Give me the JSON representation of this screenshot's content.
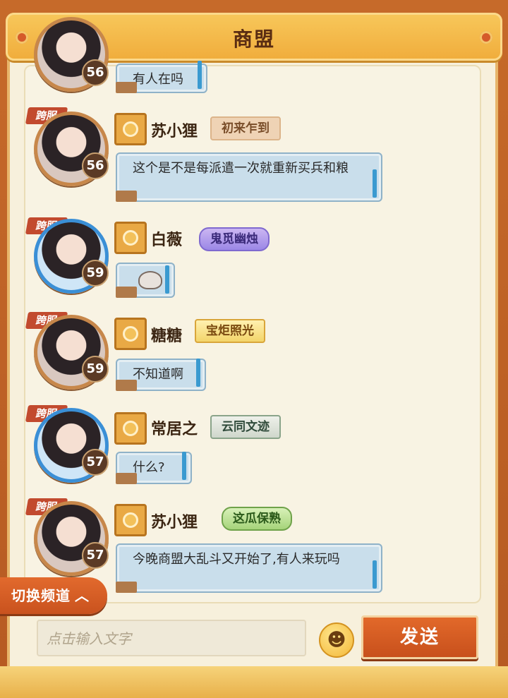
{
  "header": {
    "title": "商盟"
  },
  "messages": [
    {
      "level": "56",
      "text": "有人在吗",
      "cross": ""
    },
    {
      "cross": "跨服",
      "level": "56",
      "name": "苏小狸",
      "badge": "初来乍到",
      "text": "这个是不是每派遣一次就重新买兵和粮"
    },
    {
      "cross": "跨服",
      "level": "59",
      "name": "白薇",
      "badge": "鬼觅幽烛",
      "text": ""
    },
    {
      "cross": "跨服",
      "level": "59",
      "name": "糖糖",
      "badge": "宝炬照光",
      "text": "不知道啊"
    },
    {
      "cross": "跨服",
      "level": "57",
      "name": "常居之",
      "badge": "云同文迹",
      "text": "什么?"
    },
    {
      "cross": "跨服",
      "level": "57",
      "name": "苏小狸",
      "badge": "这瓜保熟",
      "text": "今晚商盟大乱斗又开始了,有人来玩吗"
    }
  ],
  "controls": {
    "switch_channel": "切换频道",
    "input_placeholder": "点击输入文字",
    "send": "发送",
    "emoji_icon": "smiley-icon",
    "chevron_icon": "chevron-up-icon"
  }
}
